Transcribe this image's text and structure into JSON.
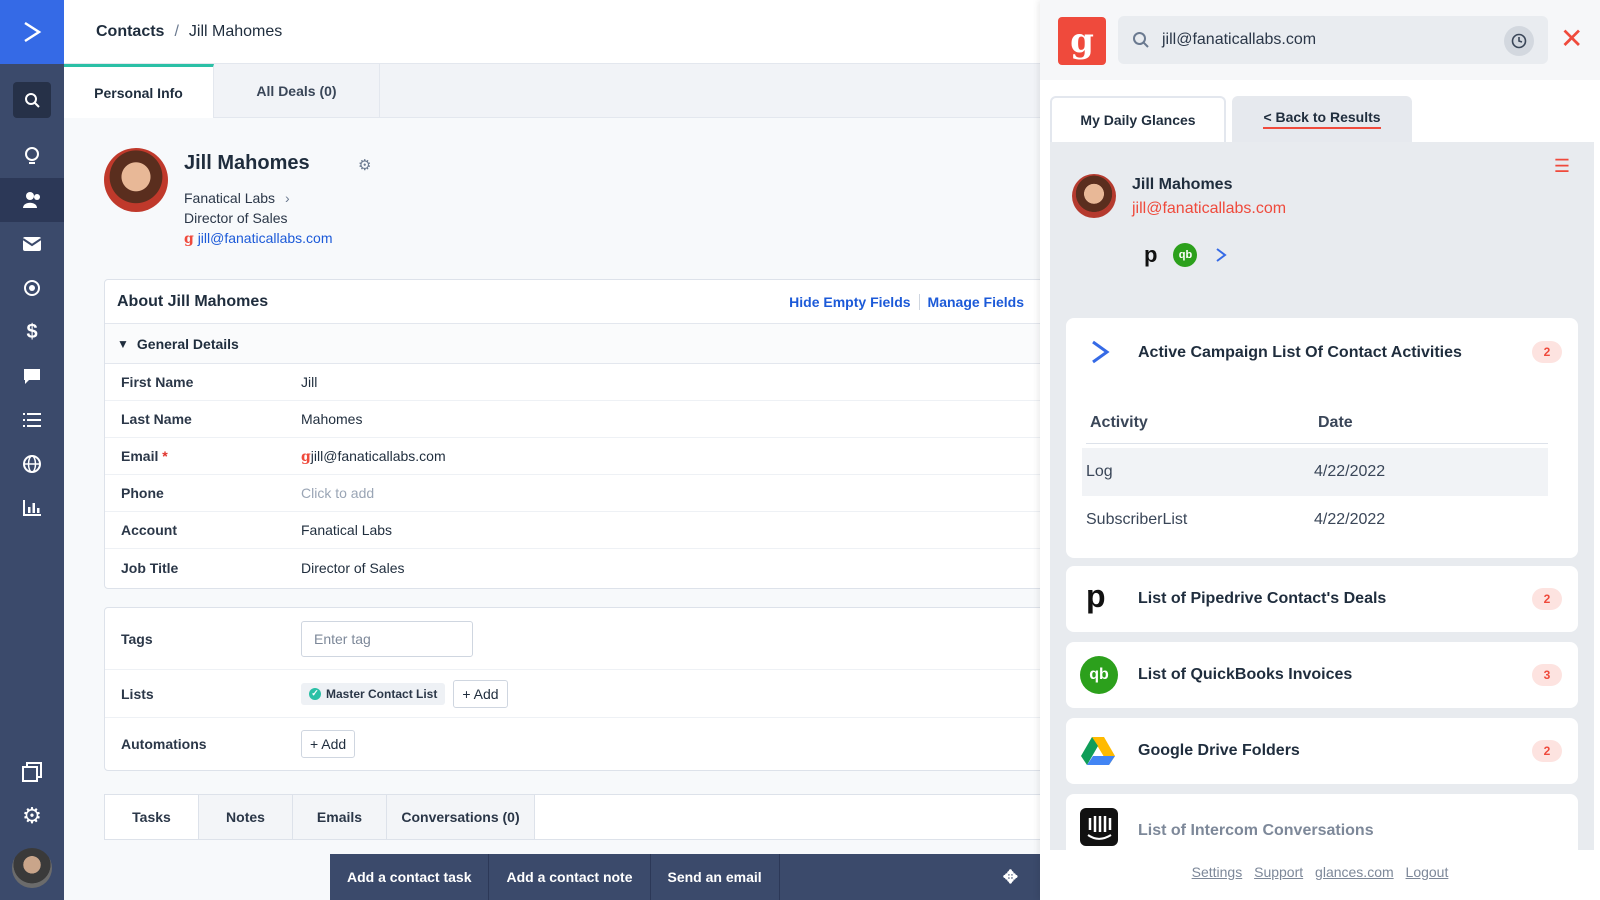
{
  "breadcrumb": {
    "root": "Contacts",
    "separator": "/",
    "current": "Jill Mahomes"
  },
  "tabs": [
    {
      "label": "Personal Info"
    },
    {
      "label": "All Deals (0)"
    }
  ],
  "profile": {
    "name": "Jill Mahomes",
    "company": "Fanatical Labs",
    "title": "Director of Sales",
    "email": "jill@fanaticallabs.com"
  },
  "about": {
    "title": "About Jill Mahomes",
    "hide_empty": "Hide Empty Fields",
    "manage_fields": "Manage Fields",
    "section": "General Details",
    "fields": [
      {
        "label": "First Name",
        "value": "Jill"
      },
      {
        "label": "Last Name",
        "value": "Mahomes"
      },
      {
        "label": "Email",
        "value": "jill@fanaticallabs.com"
      },
      {
        "label": "Phone",
        "value": "Click to add"
      },
      {
        "label": "Account",
        "value": "Fanatical Labs"
      },
      {
        "label": "Job Title",
        "value": "Director of Sales"
      }
    ]
  },
  "tags_card": {
    "tags_label": "Tags",
    "tag_placeholder": "Enter tag",
    "lists_label": "Lists",
    "list_chip": "Master Contact List",
    "add": "+ Add",
    "automations_label": "Automations"
  },
  "bottom_tabs": [
    {
      "label": "Tasks"
    },
    {
      "label": "Notes"
    },
    {
      "label": "Emails"
    },
    {
      "label": "Conversations (0)"
    }
  ],
  "actions": {
    "task": "Add a contact task",
    "note": "Add a contact note",
    "email": "Send an email"
  },
  "glances": {
    "search_value": "jill@fanaticallabs.com",
    "tab_daily": "My Daily Glances",
    "tab_back": "< Back to Results",
    "contact_name": "Jill Mahomes",
    "contact_email": "jill@fanaticallabs.com",
    "qb_icon": "qb",
    "widgets": [
      {
        "title": "Active Campaign List Of Contact Activities",
        "count": "2"
      },
      {
        "title": "List of Pipedrive Contact's Deals",
        "count": "2"
      },
      {
        "title": "List of QuickBooks Invoices",
        "count": "3"
      },
      {
        "title": "Google Drive Folders",
        "count": "2"
      },
      {
        "title": "List of Intercom Conversations"
      }
    ],
    "activity": {
      "col_activity": "Activity",
      "col_date": "Date",
      "rows": [
        {
          "activity": "Log",
          "date": "4/22/2022"
        },
        {
          "activity": "SubscriberList",
          "date": "4/22/2022"
        }
      ]
    },
    "footer": {
      "settings": "Settings",
      "support": "Support",
      "site": "glances.com",
      "logout": "Logout"
    }
  },
  "colors": {
    "nav": "#3b4a6b",
    "brand_blue": "#356ae6",
    "glances_red": "#ef4a3c",
    "accent_teal": "#2bc0a6"
  }
}
